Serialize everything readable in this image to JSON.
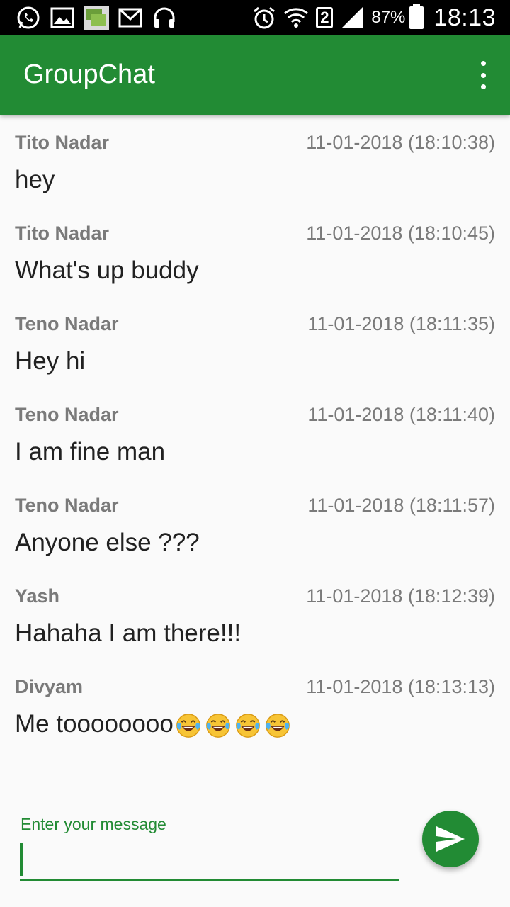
{
  "status_bar": {
    "battery_percent": "87%",
    "time": "18:13",
    "sim_slot": "2",
    "icons_left": [
      "whatsapp-icon",
      "gallery-icon",
      "chat-bubble-icon",
      "gmail-icon",
      "headset-icon"
    ],
    "icons_right": [
      "alarm-icon",
      "wifi-icon",
      "sim-2-icon",
      "signal-icon",
      "battery-icon"
    ]
  },
  "app_bar": {
    "title": "GroupChat",
    "menu_icon": "overflow-menu-icon"
  },
  "messages": [
    {
      "sender": "Tito Nadar",
      "time": "11-01-2018 (18:10:38)",
      "text": "hey"
    },
    {
      "sender": "Tito Nadar",
      "time": "11-01-2018 (18:10:45)",
      "text": "What's up buddy"
    },
    {
      "sender": "Teno Nadar",
      "time": "11-01-2018 (18:11:35)",
      "text": "Hey hi"
    },
    {
      "sender": "Teno Nadar",
      "time": "11-01-2018 (18:11:40)",
      "text": "I am fine man"
    },
    {
      "sender": "Teno Nadar",
      "time": "11-01-2018 (18:11:57)",
      "text": "Anyone else ???"
    },
    {
      "sender": "Yash",
      "time": "11-01-2018 (18:12:39)",
      "text": "Hahaha I am there!!!"
    },
    {
      "sender": "Divyam",
      "time": "11-01-2018 (18:13:13)",
      "text": "Me toooooooo",
      "emoji": "tears-of-joy-emoji",
      "emoji_count": 4
    }
  ],
  "composer": {
    "label": "Enter your message",
    "value": "",
    "send_icon": "send-icon"
  },
  "colors": {
    "primary": "#228b34",
    "status_bar": "#000000",
    "background": "#fafafa",
    "meta_text": "#7a7a7a",
    "body_text": "#212121"
  }
}
